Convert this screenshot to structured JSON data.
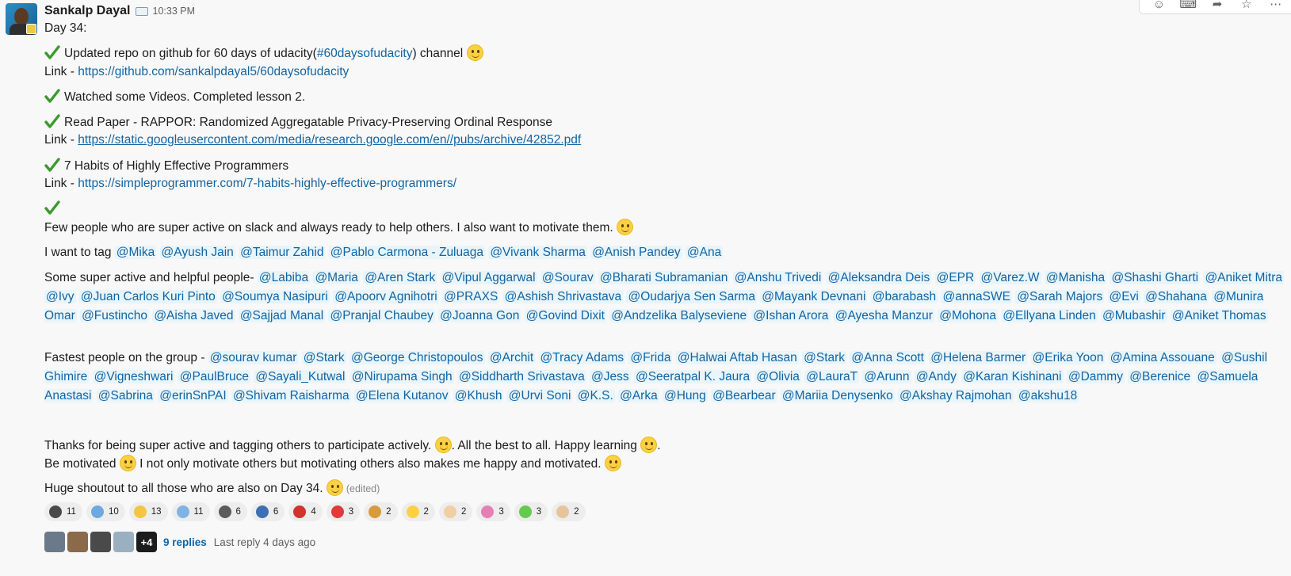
{
  "message": {
    "author": "Sankalp Dayal",
    "time": "10:33 PM",
    "day": "Day 34:",
    "item1_pre": "Updated repo on github for 60 days of udacity(",
    "item1_channel": "#60daysofudacity",
    "item1_post": ")  channel",
    "link_prefix": "Link - ",
    "link1": "https://github.com/sankalpdayal5/60daysofudacity",
    "item2": "Watched some Videos. Completed lesson 2.",
    "item3": "Read Paper - RAPPOR: Randomized Aggregatable Privacy-Preserving Ordinal Response",
    "link2": "https://static.googleusercontent.com/media/research.google.com/en//pubs/archive/42852.pdf",
    "item4": "7 Habits of Highly Effective Programmers",
    "link3": "https://simpleprogrammer.com/7-habits-highly-effective-programmers/",
    "item5": "Few people who are super active on slack and always ready to help others. I also want to motivate them.",
    "tag_intro": "I want to tag ",
    "tag_mentions": [
      "@Mika",
      "@Ayush Jain",
      "@Taimur Zahid",
      "@Pablo Carmona - Zuluaga",
      "@Vivank Sharma",
      "@Anish Pandey",
      "@Ana"
    ],
    "helpful_intro": "Some super active and helpful people- ",
    "helpful_mentions": [
      "@Labiba",
      "@Maria",
      "@Aren Stark",
      "@Vipul Aggarwal",
      "@Sourav",
      "@Bharati Subramanian",
      "@Anshu Trivedi",
      "@Aleksandra Deis",
      "@EPR",
      "@Varez.W",
      "@Manisha",
      "@Shashi Gharti",
      "@Aniket Mitra",
      "@Ivy",
      "@Juan Carlos Kuri Pinto",
      "@Soumya Nasipuri",
      "@Apoorv Agnihotri",
      "@PRAXS",
      "@Ashish Shrivastava",
      "@Oudarjya Sen Sarma",
      "@Mayank Devnani",
      "@barabash",
      "@annaSWE",
      "@Sarah Majors",
      "@Evi",
      "@Shahana",
      "@Munira Omar",
      "@Fustincho",
      "@Aisha Javed",
      "@Sajjad Manal",
      "@Pranjal Chaubey",
      "@Joanna Gon",
      "@Govind Dixit",
      "@Andzelika Balyseviene",
      "@Ishan Arora",
      "@Ayesha Manzur",
      "@Mohona",
      "@Ellyana Linden",
      "@Mubashir",
      "@Aniket Thomas"
    ],
    "fastest_intro": "Fastest people on the group - ",
    "fastest_mentions": [
      "@sourav kumar",
      "@Stark",
      "@George Christopoulos",
      "@Archit",
      "@Tracy Adams",
      "@Frida",
      "@Halwai Aftab Hasan",
      "@Stark",
      "@Anna Scott",
      "@Helena Barmer",
      "@Erika Yoon",
      "@Amina Assouane",
      "@Sushil Ghimire",
      "@Vigneshwari",
      "@PaulBruce",
      "@Sayali_Kutwal",
      "@Nirupama Singh",
      "@Siddharth Srivastava",
      "@Jess",
      "@Seeratpal K. Jaura",
      "@Olivia",
      "@LauraT",
      "@Arunn",
      "@Andy",
      "@Karan Kishinani",
      "@Dammy",
      "@Berenice",
      "@Samuela Anastasi",
      "@Sabrina",
      "@erinSnPAI",
      "@Shivam Raisharma",
      "@Elena Kutanov",
      "@Khush",
      "@Urvi Soni",
      "@K.S.",
      "@Arka",
      "@Hung",
      "@Bearbear",
      "@Mariia Denysenko",
      "@Akshay Rajmohan",
      "@akshu18"
    ],
    "thanks_a": "Thanks for being super active and tagging others to participate actively. ",
    "thanks_b": ". All the best to all. Happy learning ",
    "thanks_c": ".",
    "motivated_a": "Be motivated ",
    "motivated_b": " I not only motivate others but motivating others also makes me happy and motivated. ",
    "shoutout": "Huge shoutout to all those who are also on Day 34. ",
    "edited": "(edited)"
  },
  "reactions": [
    {
      "icon": "penguin-icon",
      "count": "11",
      "color": "#4a4a4a"
    },
    {
      "icon": "wave-icon",
      "count": "10",
      "color": "#6fa8dc"
    },
    {
      "icon": "thumbsup-icon",
      "count": "13",
      "color": "#f4c542"
    },
    {
      "icon": "thankyou-icon",
      "count": "11",
      "color": "#7fb3e6"
    },
    {
      "icon": "dancer-icon",
      "count": "6",
      "color": "#5b5b5b"
    },
    {
      "icon": "rocket-icon",
      "count": "6",
      "color": "#3d6fb4"
    },
    {
      "icon": "hundred-icon",
      "count": "4",
      "color": "#d0342c"
    },
    {
      "icon": "target-icon",
      "count": "3",
      "color": "#e03a3a"
    },
    {
      "icon": "gymnast-icon",
      "count": "2",
      "color": "#d99a3b"
    },
    {
      "icon": "grin-icon",
      "count": "2",
      "color": "#fbd043"
    },
    {
      "icon": "thumbsup-light-icon",
      "count": "2",
      "color": "#f1cfa3"
    },
    {
      "icon": "blob-icon",
      "count": "3",
      "color": "#e67fb5"
    },
    {
      "icon": "party-blob-icon",
      "count": "3",
      "color": "#67c94f"
    },
    {
      "icon": "raised-hands-icon",
      "count": "2",
      "color": "#e8c49a"
    }
  ],
  "thread": {
    "avatars": [
      {
        "color": "#6a7a8a"
      },
      {
        "color": "#8a6a4a"
      },
      {
        "color": "#4a4a4a"
      },
      {
        "color": "#9ab0c0"
      }
    ],
    "more": "+4",
    "replies": "9 replies",
    "last_reply": "Last reply 4 days ago"
  }
}
